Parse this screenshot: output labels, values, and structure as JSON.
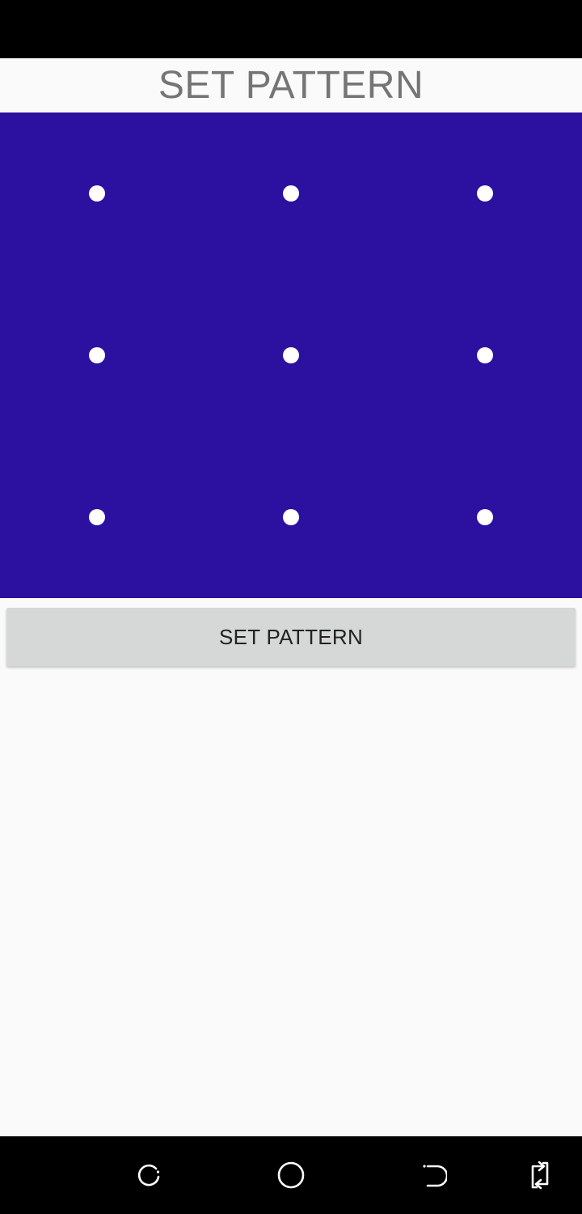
{
  "title": "SET PATTERN",
  "pattern": {
    "background_color": "#2c10a0",
    "dot_color": "#ffffff",
    "dot_count": 9,
    "grid": "3x3"
  },
  "set_button_label": "SET PATTERN",
  "nav_bar": {
    "items": [
      {
        "icon": "recents-icon"
      },
      {
        "icon": "home-icon"
      },
      {
        "icon": "back-icon"
      },
      {
        "icon": "rotate-icon"
      }
    ]
  }
}
